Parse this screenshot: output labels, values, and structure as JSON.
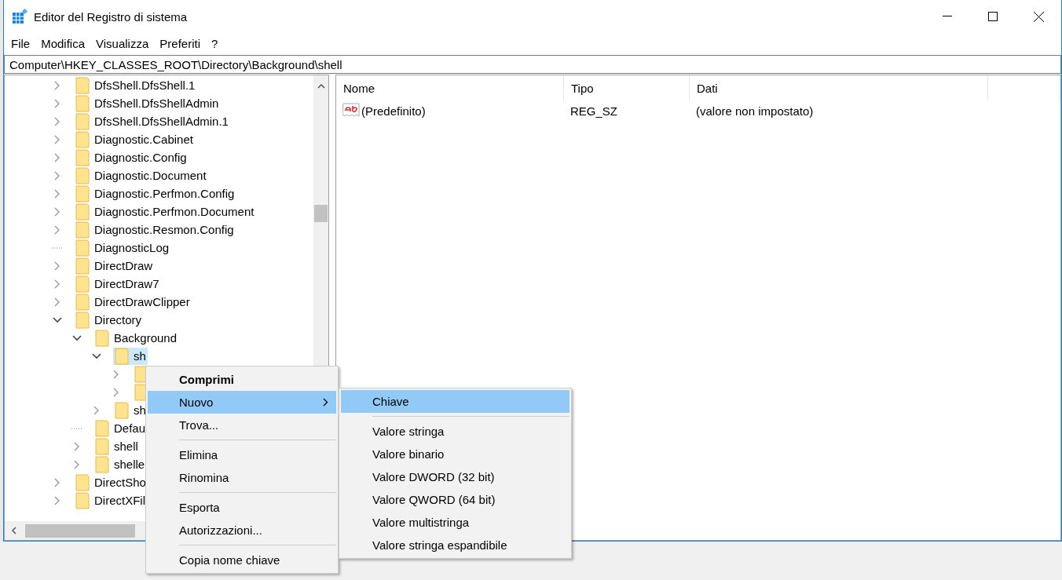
{
  "window": {
    "title": "Editor del Registro di sistema"
  },
  "menu_bar": [
    "File",
    "Modifica",
    "Visualizza",
    "Preferiti",
    "?"
  ],
  "address_bar": {
    "value": "Computer\\HKEY_CLASSES_ROOT\\Directory\\Background\\shell"
  },
  "tree": [
    {
      "label": "DfsShell.DfsShell.1",
      "expandable": true,
      "expanded": false,
      "selected": false
    },
    {
      "label": "DfsShell.DfsShellAdmin",
      "expandable": true,
      "expanded": false,
      "selected": false
    },
    {
      "label": "DfsShell.DfsShellAdmin.1",
      "expandable": true,
      "expanded": false,
      "selected": false
    },
    {
      "label": "Diagnostic.Cabinet",
      "expandable": true,
      "expanded": false,
      "selected": false
    },
    {
      "label": "Diagnostic.Config",
      "expandable": true,
      "expanded": false,
      "selected": false
    },
    {
      "label": "Diagnostic.Document",
      "expandable": true,
      "expanded": false,
      "selected": false
    },
    {
      "label": "Diagnostic.Perfmon.Config",
      "expandable": true,
      "expanded": false,
      "selected": false
    },
    {
      "label": "Diagnostic.Perfmon.Document",
      "expandable": true,
      "expanded": false,
      "selected": false
    },
    {
      "label": "Diagnostic.Resmon.Config",
      "expandable": true,
      "expanded": false,
      "selected": false
    },
    {
      "label": "DiagnosticLog",
      "expandable": false,
      "selected": false
    },
    {
      "label": "DirectDraw",
      "expandable": true,
      "expanded": false,
      "selected": false
    },
    {
      "label": "DirectDraw7",
      "expandable": true,
      "expanded": false,
      "selected": false
    },
    {
      "label": "DirectDrawClipper",
      "expandable": true,
      "expanded": false,
      "selected": false
    },
    {
      "label": "Directory",
      "expandable": true,
      "expanded": true,
      "selected": false,
      "children": [
        {
          "label": "Background",
          "expandable": true,
          "expanded": true,
          "selected": false,
          "children": [
            {
              "label": "sh",
              "expandable": true,
              "expanded": true,
              "selected": true,
              "children": [
                {
                  "expandable": true,
                  "expanded": false,
                  "selected": false
                },
                {
                  "expandable": true,
                  "expanded": false,
                  "selected": false
                }
              ]
            },
            {
              "label": "sh",
              "expandable": true,
              "expanded": false,
              "selected": false
            }
          ]
        },
        {
          "label": "Defau",
          "expandable": false,
          "selected": false
        },
        {
          "label": "shell",
          "expandable": true,
          "expanded": false,
          "selected": false
        },
        {
          "label": "shelle",
          "expandable": true,
          "expanded": false,
          "selected": false
        }
      ]
    },
    {
      "label": "DirectSho",
      "expandable": true,
      "expanded": false,
      "selected": false
    },
    {
      "label": "DirectXFil",
      "expandable": true,
      "expanded": false,
      "selected": false
    }
  ],
  "values": {
    "columns": [
      "Nome",
      "Tipo",
      "Dati"
    ],
    "rows": [
      {
        "name": "(Predefinito)",
        "type": "REG_SZ",
        "data": "(valore non impostato)"
      }
    ]
  },
  "context_menu": [
    {
      "kind": "item",
      "label": "Comprimi",
      "default": true,
      "selected": false,
      "submenu": false
    },
    {
      "kind": "item",
      "label": "Nuovo",
      "default": false,
      "selected": true,
      "submenu": true
    },
    {
      "kind": "item",
      "label": "Trova...",
      "default": false,
      "selected": false,
      "submenu": false
    },
    {
      "kind": "separator"
    },
    {
      "kind": "item",
      "label": "Elimina",
      "default": false,
      "selected": false,
      "submenu": false
    },
    {
      "kind": "item",
      "label": "Rinomina",
      "default": false,
      "selected": false,
      "submenu": false
    },
    {
      "kind": "separator"
    },
    {
      "kind": "item",
      "label": "Esporta",
      "default": false,
      "selected": false,
      "submenu": false
    },
    {
      "kind": "item",
      "label": "Autorizzazioni...",
      "default": false,
      "selected": false,
      "submenu": false
    },
    {
      "kind": "separator"
    },
    {
      "kind": "item",
      "label": "Copia nome chiave",
      "default": false,
      "selected": false,
      "submenu": false
    }
  ],
  "submenu": [
    {
      "kind": "item",
      "label": "Chiave",
      "selected": true
    },
    {
      "kind": "separator"
    },
    {
      "kind": "item",
      "label": "Valore stringa",
      "selected": false
    },
    {
      "kind": "item",
      "label": "Valore binario",
      "selected": false
    },
    {
      "kind": "item",
      "label": "Valore DWORD (32 bit)",
      "selected": false
    },
    {
      "kind": "item",
      "label": "Valore QWORD (64 bit)",
      "selected": false
    },
    {
      "kind": "item",
      "label": "Valore multistringa",
      "selected": false
    },
    {
      "kind": "item",
      "label": "Valore stringa espandibile",
      "selected": false
    }
  ]
}
